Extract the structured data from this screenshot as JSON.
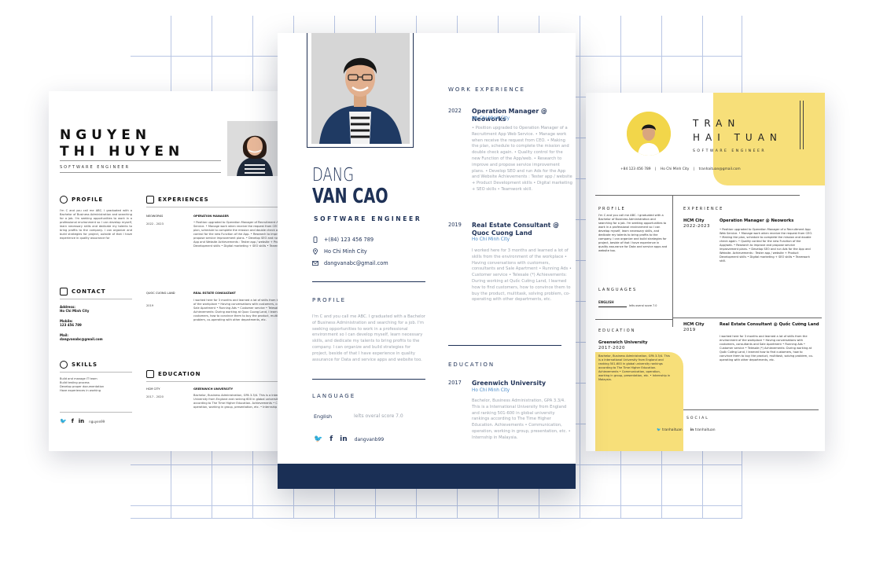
{
  "left_resume": {
    "name_line1": "NGUYEN",
    "name_line2": "THI HUYEN",
    "job_title": "SOFTWARE ENGINEER",
    "profile_heading": "PROFILE",
    "profile_text": "I'm C and you call me ABC. I graduated with a Bachelor of Business Administration and searching for a job. I'm seeking opportunities to work in a professional environment so I can develop myself, learn necessary skills and dedicate my talents to bring profits to the company. I can organize and build strategies for project, outside of that I have experience in quality assurance for",
    "experiences_heading": "EXPERIENCES",
    "exp1_company": "NEOWORKS",
    "exp1_dates": "2022 - 2023",
    "exp1_role": "OPERATION MANAGER",
    "exp1_text": "• Position upgraded to Operation Manager of Recruitment App Web Service. • Manage work when receive the request from CEO. • Making the plan, schedule to complete the mission and double check again. • Quality control for the new Function of the App. • Research to improve and propose service improvement plans. • Develop SEO and run Ads for the App and Website Achievements : Tester app / website + Product Development skills • Digital marketing + SEO skills • Teamwork skill",
    "exp2_company": "QUOC CUONG LAND",
    "exp2_dates": "2019",
    "exp2_role": "REAL ESTATE CONSULTANT",
    "exp2_text": "I worked here for 3 months and learned a lot of skills from the environment of the workplace • Having conversations with customers, consultants and Sale Apartment • Running Ads • Customer service • Telesale (*) Achievements: During working at Quoc Cuong Land, I learned how to find customers, how to convince them to buy the product, multitask, solving problem, co-operating with other departments, etc.",
    "contact_heading": "CONTACT",
    "address_label": "Address:",
    "address_value": "Ho Chi Minh City",
    "mobile_label": "Mobile:",
    "mobile_value": "123 456 789",
    "mail_label": "Mail:",
    "mail_value": "dangvanabc@gmail.com",
    "skills_heading": "SKILLS",
    "skills": [
      "Build and manage IT team",
      "Build testing process",
      "Develop proper documentation",
      "Have experiences in working"
    ],
    "education_heading": "EDUCATION",
    "edu_city": "HCM CITY",
    "edu_dates": "2017 - 2020",
    "edu_school": "GREENWICH UNIVERSITY",
    "edu_text": "Bachelor, Business Administration, GPA 3.3/4. This is a International University from England and ranking 600 in global university rankings according to The Time Higher Education. Achievements • Communication, operation, working in group, presentation, etc. • Internship in Malaysia.",
    "social_handle": "nguyen99"
  },
  "center_resume": {
    "first_name": "DANG",
    "last_name": "VAN CAO",
    "job_title": "SOFTWARE ENGINEER",
    "phone": "+(84) 123 456 789",
    "location": "Ho Chi Minh City",
    "email": "dangvanabc@gmail.com",
    "profile_heading": "PROFILE",
    "profile_text": "I'm C and you call me ABC. I graduated with a Bachelor of Business Administration and searching for a job. I'm seeking opportunities to work in a professional environment so I can develop myself, learn necessary skills, and dedicate my talents to bring profits to the company. I can organize and build strategies for project, beside of that I have experience in quality assurance for Data and service apps and website too.",
    "language_heading": "LANGUAGE",
    "language_name": "English",
    "language_score": "Ielts overal score 7.0",
    "social_handle": "dangvanb99",
    "work_heading": "WORK EXPERIENCE",
    "job1_year": "2022",
    "job1_role": "Operation Manager @ Neoworks",
    "job1_location": "Ho Chi Minh City",
    "job1_text": "• Position upgraded to Operation Manager of a Recruitment App Web Service. • Manage work when receive the request from CEO. • Making the plan, schedule to complete the mission and double check again. • Quality control for the new Function of the App/web. • Research to improve and propose service improvement plans. • Develop SEO and run Ads for the App and Website Achievements : Tester app / website + Product Development skills • Digital marketing + SEO skills • Teamwork skill.",
    "job2_year": "2019",
    "job2_role": "Real Estate Consultant @ Quoc Cuong Land",
    "job2_location": "Ho Chi Minh City",
    "job2_text": "I worked here for 3 months and learned a lot of skills from the environment of the workplace • Having conversations with customers, consultants and Sale Apartment • Running Ads • Customer service • Telesale (*) Achievements: During working at Quốc Cường Land, I learned how to find customers, how to convince them to buy the product, multitask, solving problem, co-operating with other departments, etc.",
    "education_heading": "EDUCATION",
    "edu_year": "2017",
    "edu_school": "Greenwich University",
    "edu_location": "Ho Chi Minh City",
    "edu_text": "Bachelor, Business Administration, GPA 3.3/4. This is a International University from England and ranking 501-600 in global university rankings according to The Time Higher Education. Achievements • Communication, operation, working in group, presentation, etc. • Internship in Malaysia."
  },
  "right_resume": {
    "name_line1": "TRAN",
    "name_line2": "HAI TUAN",
    "job_title": "SOFTWARE ENGINEER",
    "phone": "+84 123 456 789",
    "location": "Ho Chi Minh City",
    "email": "tranhaituan@gmail.com",
    "profile_heading": "PROFILE",
    "profile_text": "I'm C and you call me ABC. I graduated with a Bachelor of Business Administration and searching for a job. I'm seeking opportunities to work in a professional environment so I can develop myself, learn necessary skills, and dedicate my talents to bring profits to the company. I can organize and build strategies for project, beside of that I have experience in quality assurance for Data and service apps and website too.",
    "languages_heading": "LANGUAGES",
    "language_name": "ENGLISH",
    "language_score": "Ielts overal score 7.0",
    "education_heading": "EDUCATION",
    "edu_school": "Greenwich University",
    "edu_years": "2017-2020",
    "edu_text": "Bachelor, Business Administration, GPA 3.3/4. This is a International University from England and ranking 501-600 in global university rankings according to The Time Higher Education. Achievements • Communication, operation, working in group, presentation, etc. • Internship in Malaysia.",
    "experience_heading": "EXPERIENCE",
    "exp1_city": "HCM City",
    "exp1_years": "2022-2023",
    "exp1_role": "Operation Manager @ Neoworks",
    "exp1_text": "• Position upgraded to Operation Manager of a Recruitment App Web Service. • Manage work when receive the request from CEO. • Making the plan, schedule to complete the mission and double check again. • Quality control for the new Function of the App/web. • Research to improve and propose service improvement plans. • Develop SEO and run Ads for the App and Website. Achievements : Tester app / website + Product Development skills • Digital marketing + SEO skills • Teamwork skill.",
    "exp2_city": "HCM City",
    "exp2_years": "2019",
    "exp2_role": "Real Estate Consultant @ Quốc Cường Land",
    "exp2_text": "I worked here for 3 months and learned a lot of skills from the environment of the workplace • Having conversations with customers, consultants and Sale Apartment • Running Ads • Customer service • Telesale (*) Achievements: During working at Quốc Cường Land, I learned how to find customers, how to convince them to buy the product, multitask, solving problem, co-operating with other departments, etc.",
    "social_heading": "SOCIAL",
    "twitter_handle": "tranhaituan",
    "linkedin_handle": "tranhaituan"
  }
}
